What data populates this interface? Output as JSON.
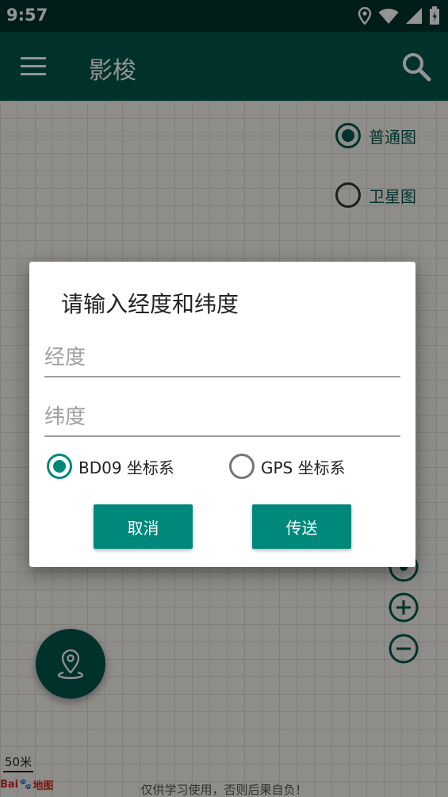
{
  "status_bar": {
    "time": "9:57"
  },
  "app_bar": {
    "title": "影梭"
  },
  "map": {
    "layer_options": [
      {
        "label": "普通图",
        "selected": true
      },
      {
        "label": "卫星图",
        "selected": false
      }
    ],
    "scale_label": "50米",
    "logo_text_left": "Bai",
    "logo_text_right": "地图",
    "disclaimer": "仅供学习使用，否则后果自负！"
  },
  "dialog": {
    "title": "请输入经度和纬度",
    "longitude_placeholder": "经度",
    "latitude_placeholder": "纬度",
    "longitude_value": "",
    "latitude_value": "",
    "coord_options": [
      {
        "label": "BD09 坐标系",
        "selected": true
      },
      {
        "label": "GPS 坐标系",
        "selected": false
      }
    ],
    "cancel_label": "取消",
    "send_label": "传送"
  },
  "colors": {
    "primary": "#00574b",
    "primary_dark": "#00332c",
    "accent": "#00897b"
  }
}
